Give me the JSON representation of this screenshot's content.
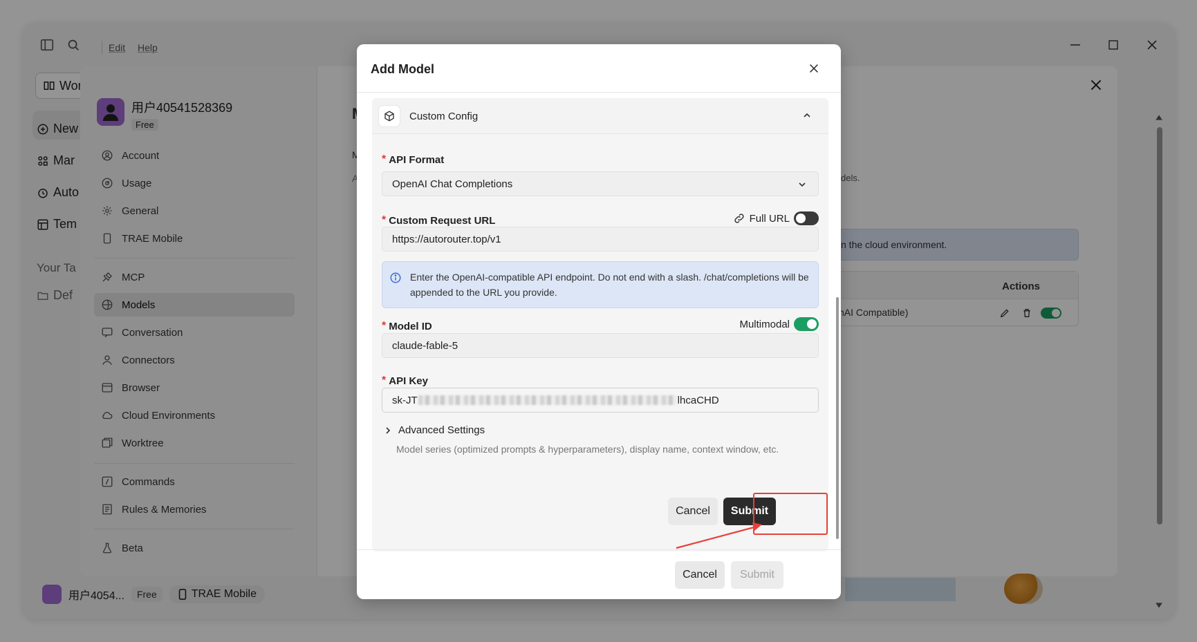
{
  "menu": {
    "edit": "Edit",
    "help": "Help"
  },
  "app_sidebar": {
    "workspace_label": "Wor",
    "new_label": "New",
    "market_label": "Mar",
    "auto_label": "Auto",
    "templates_label": "Tem",
    "your_tasks_label": "Your Ta",
    "default_label": "Def"
  },
  "bottom_bar": {
    "user": "用户4054...",
    "plan": "Free",
    "mobile": "TRAE Mobile"
  },
  "settings": {
    "username": "用户40541528369",
    "plan": "Free",
    "nav": [
      {
        "label": "Account"
      },
      {
        "label": "Usage"
      },
      {
        "label": "General"
      },
      {
        "label": "TRAE Mobile"
      },
      {
        "label": "MCP"
      },
      {
        "label": "Models"
      },
      {
        "label": "Conversation"
      },
      {
        "label": "Connectors"
      },
      {
        "label": "Browser"
      },
      {
        "label": "Cloud Environments"
      },
      {
        "label": "Worktree"
      },
      {
        "label": "Commands"
      },
      {
        "label": "Rules & Memories"
      },
      {
        "label": "Beta"
      }
    ],
    "bg_fragments": {
      "heading_initial": "M",
      "sub_initial": "M",
      "a_initial": "A",
      "models_tail": "dels.",
      "cloud_notice": "n the cloud environment.",
      "actions_header": "Actions",
      "row_text": "nAI Compatible)"
    }
  },
  "modal": {
    "title": "Add Model",
    "section_title": "Custom Config",
    "api_format": {
      "label": "API Format",
      "value": "OpenAI Chat Completions"
    },
    "request_url": {
      "label": "Custom Request URL",
      "value": "https://autorouter.top/v1",
      "full_url_label": "Full URL",
      "full_url_enabled": false
    },
    "info": "Enter the OpenAI-compatible API endpoint. Do not end with a slash. /chat/completions will be appended to the URL you provide.",
    "model_id": {
      "label": "Model ID",
      "value": "claude-fable-5",
      "multimodal_label": "Multimodal",
      "multimodal_enabled": true
    },
    "api_key": {
      "label": "API Key",
      "prefix": "sk-JT",
      "suffix": "lhcaCHD"
    },
    "advanced": {
      "title": "Advanced Settings",
      "desc": "Model series (optimized prompts & hyperparameters), display name, context window, etc."
    },
    "inner_cancel": "Cancel",
    "inner_submit": "Submit",
    "footer_cancel": "Cancel",
    "footer_submit": "Submit"
  },
  "colors": {
    "accent_green": "#1b9e62",
    "highlight_red": "#e8403a",
    "submit_dark": "#2b2b2b",
    "required_red": "#e23838"
  }
}
